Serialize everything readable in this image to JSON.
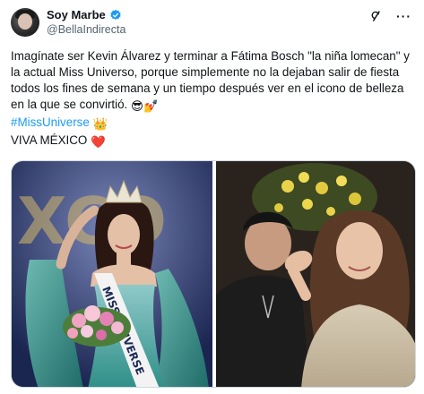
{
  "author": {
    "display_name": "Soy Marbe",
    "handle": "@BellaIndirecta",
    "verified": true,
    "avatar_icon": "avatar-photo"
  },
  "actions": {
    "grok_icon": "grok-icon",
    "more_icon": "more-options-icon"
  },
  "post": {
    "line1": "Imagínate ser Kevin Álvarez y terminar a Fátima Bosch \"la niña lomecan\" y la actual Miss Universo, porque simplemente no la dejaban salir de fiesta todos los fines de semana y un tiempo después ver en el icono de belleza en la que se convirtió.",
    "emojis1": "😎💅",
    "hashtag": "#MissUniverse",
    "hashtag_emoji": "👑",
    "line3": "VIVA MÉXICO",
    "line3_emoji": "❤️"
  },
  "media": {
    "left_sash_text": "MISS UNIVERSE",
    "left_backdrop_text": "XCO",
    "colors": {
      "link": "#1d9bf0",
      "verified": "#1d9bf0"
    }
  }
}
